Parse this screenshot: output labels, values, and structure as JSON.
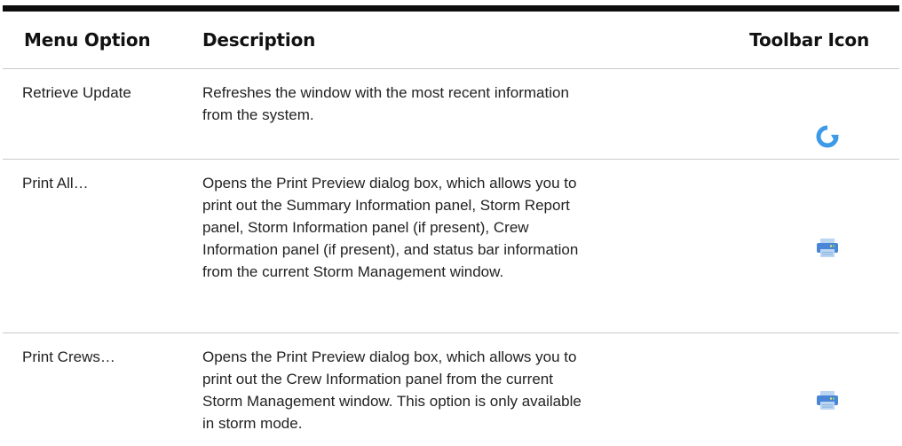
{
  "table": {
    "headers": {
      "menu_option": "Menu Option",
      "description": "Description",
      "toolbar_icon": "Toolbar Icon"
    },
    "rows": [
      {
        "menu_option": "Retrieve Update",
        "description": "Refreshes the window with the most recent information\nfrom the system.",
        "icon": "refresh-icon"
      },
      {
        "menu_option": "Print All…",
        "description": "Opens the Print Preview dialog box, which allows you to\nprint out the Summary Information panel, Storm Report\npanel, Storm Information panel (if present), Crew\nInformation panel (if present), and status bar information\nfrom the current Storm Management window.",
        "icon": "printer-icon"
      },
      {
        "menu_option": "Print Crews…",
        "description": "Opens the Print Preview dialog box, which allows you to\nprint out the Crew Information panel from the current\nStorm Management window. This option is only available\nin storm mode.",
        "icon": "printer-icon"
      }
    ]
  },
  "colors": {
    "rule": "#0d0d0d",
    "divider": "#c9c9c9",
    "icon_blue": "#3d9ae8",
    "printer_dark": "#4a86d8",
    "printer_light": "#bcd6f2",
    "printer_accent": "#7ed957"
  }
}
